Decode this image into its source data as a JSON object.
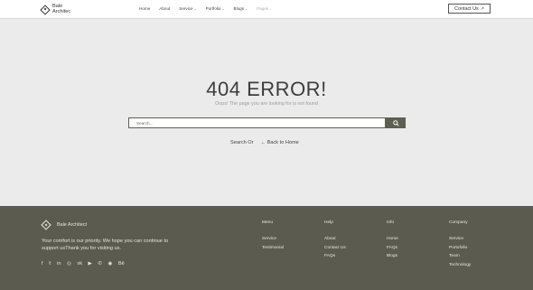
{
  "header": {
    "logo_line1": "Bale",
    "logo_line2": "Architec",
    "nav": [
      {
        "label": "Home",
        "dropdown": false,
        "muted": false
      },
      {
        "label": "About",
        "dropdown": false,
        "muted": false
      },
      {
        "label": "Service",
        "dropdown": true,
        "muted": false
      },
      {
        "label": "Portfolio",
        "dropdown": true,
        "muted": false
      },
      {
        "label": "Blogs",
        "dropdown": true,
        "muted": false
      },
      {
        "label": "Pages",
        "dropdown": true,
        "muted": true
      }
    ],
    "cta_label": "Contact Us",
    "cta_icon": "arrow-up-right-icon"
  },
  "main": {
    "title": "404 ERROR!",
    "subtitle": "Oops! The page you are looking for is not found",
    "search_placeholder": "Search...",
    "search_icon": "search-icon",
    "search_or": "Search Or",
    "back_label": "Back to Home"
  },
  "footer": {
    "brand": "Bale Architect",
    "description": "Your comfort is our priority. We hope you can continue to support usThank you for visiting us.",
    "socials": [
      "facebook-icon",
      "twitter-icon",
      "linkedin-icon",
      "dribbble-icon",
      "vk-icon",
      "youtube-icon",
      "whatsapp-icon",
      "instagram-icon",
      "behance-icon"
    ],
    "columns": [
      {
        "heading": "Menu",
        "items": [
          "Service",
          "Testimonial"
        ]
      },
      {
        "heading": "Help",
        "items": [
          "About",
          "Contact Us",
          "FAQs"
        ]
      },
      {
        "heading": "Info",
        "items": [
          "Home",
          "FAQs",
          "Blogs"
        ]
      },
      {
        "heading": "Company",
        "items": [
          "Service",
          "Portofolio",
          "Team",
          "Technology"
        ]
      }
    ]
  },
  "colors": {
    "accent": "#5e5f53",
    "footer_bg": "#5b5c4f",
    "page_bg": "#ebebeb"
  }
}
